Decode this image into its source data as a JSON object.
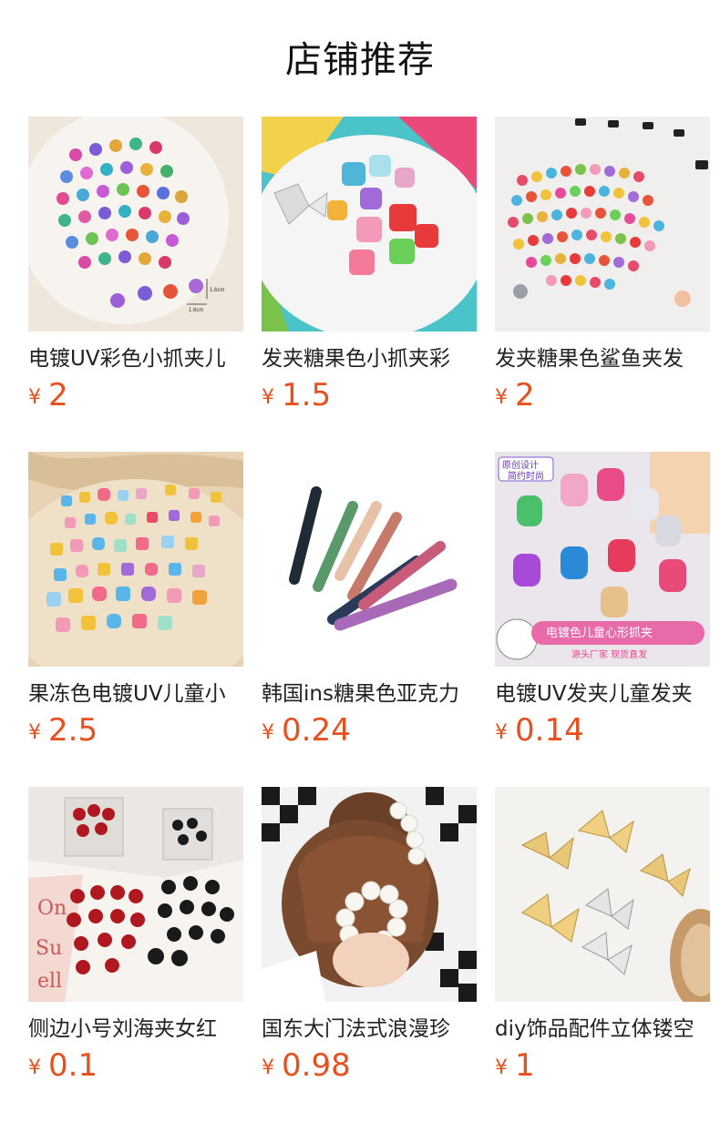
{
  "header": {
    "title": "店铺推荐"
  },
  "currency_symbol": "¥",
  "products": [
    {
      "title": "电镀UV彩色小抓夹儿",
      "price": "2",
      "image_labels": [
        "1.6cm",
        "1.6cm"
      ]
    },
    {
      "title": "发夹糖果色小抓夹彩",
      "price": "1.5"
    },
    {
      "title": "发夹糖果色鲨鱼夹发",
      "price": "2"
    },
    {
      "title": "果冻色电镀UV儿童小",
      "price": "2.5"
    },
    {
      "title": "韩国ins糖果色亚克力",
      "price": "0.24"
    },
    {
      "title": "电镀UV发夹儿童发夹",
      "price": "0.14",
      "image_labels": [
        "原创设计",
        "简约时尚",
        "电镀色儿童心形抓夹",
        "源头厂家 现货直发"
      ]
    },
    {
      "title": "侧边小号刘海夹女红",
      "price": "0.1",
      "image_labels": [
        "On",
        "Su",
        "ell"
      ]
    },
    {
      "title": "国东大门法式浪漫珍",
      "price": "0.98"
    },
    {
      "title": "diy饰品配件立体镂空",
      "price": "1"
    }
  ]
}
